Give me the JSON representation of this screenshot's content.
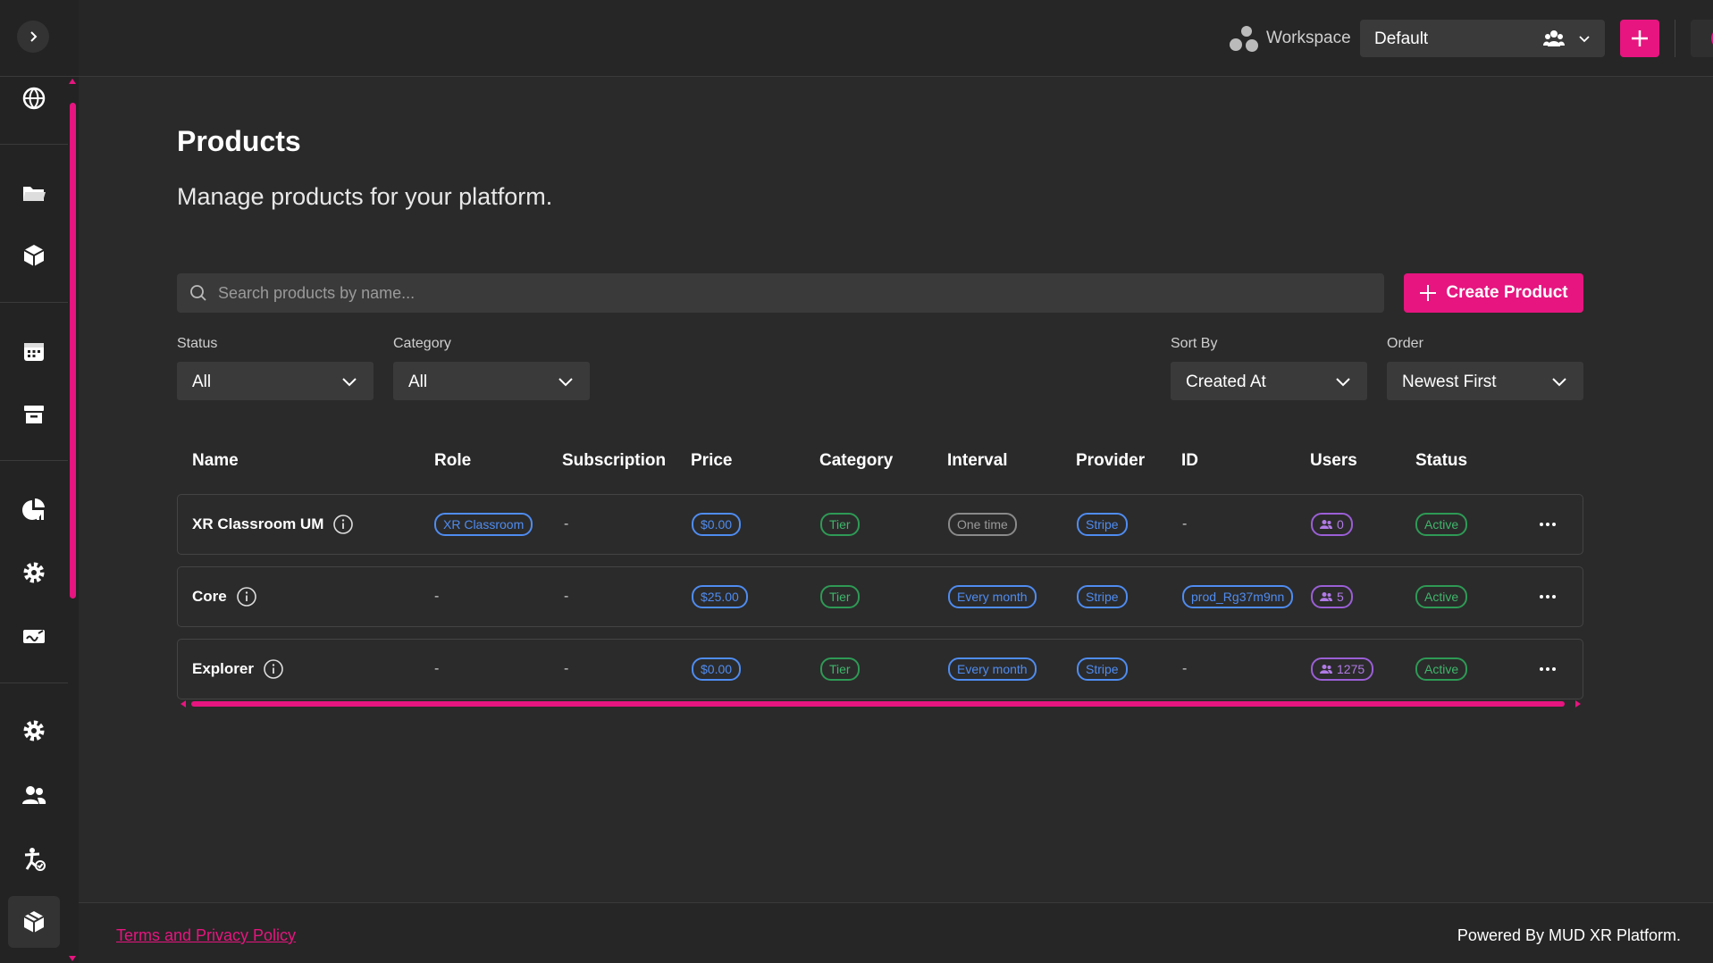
{
  "topbar": {
    "workspace_label": "Workspace",
    "workspace_value": "Default"
  },
  "page": {
    "title": "Products",
    "subtitle": "Manage products for your platform."
  },
  "search": {
    "placeholder": "Search products by name..."
  },
  "create_button": "Create Product",
  "filters": {
    "status": {
      "label": "Status",
      "value": "All"
    },
    "category": {
      "label": "Category",
      "value": "All"
    },
    "sort_by": {
      "label": "Sort By",
      "value": "Created At"
    },
    "order": {
      "label": "Order",
      "value": "Newest First"
    }
  },
  "table": {
    "headers": [
      "Name",
      "Role",
      "Subscription",
      "Price",
      "Category",
      "Interval",
      "Provider",
      "ID",
      "Users",
      "Status"
    ],
    "rows": [
      {
        "name": "XR Classroom UM",
        "role": "XR Classroom",
        "subscription": "-",
        "price": "$0.00",
        "category": "Tier",
        "interval": "One time",
        "provider": "Stripe",
        "id": "-",
        "users": "0",
        "status": "Active"
      },
      {
        "name": "Core",
        "role": "-",
        "subscription": "-",
        "price": "$25.00",
        "category": "Tier",
        "interval": "Every month",
        "provider": "Stripe",
        "id": "prod_Rg37m9nn",
        "users": "5",
        "status": "Active"
      },
      {
        "name": "Explorer",
        "role": "-",
        "subscription": "-",
        "price": "$0.00",
        "category": "Tier",
        "interval": "Every month",
        "provider": "Stripe",
        "id": "-",
        "users": "1275",
        "status": "Active"
      }
    ]
  },
  "footer": {
    "terms": "Terms and Privacy Policy",
    "powered": "Powered By MUD XR Platform."
  },
  "colors": {
    "accent": "#e6157f",
    "blue": "#4f8cf0",
    "green": "#3fb66b",
    "purple": "#b07ae6"
  },
  "sidebar_icons": [
    "globe-icon",
    "folder-icon",
    "cube-icon",
    "calendar-icon",
    "archive-icon",
    "pie-chart-icon",
    "settings-icon",
    "signature-icon",
    "gear-icon",
    "users-icon",
    "accessibility-icon",
    "package-icon"
  ]
}
